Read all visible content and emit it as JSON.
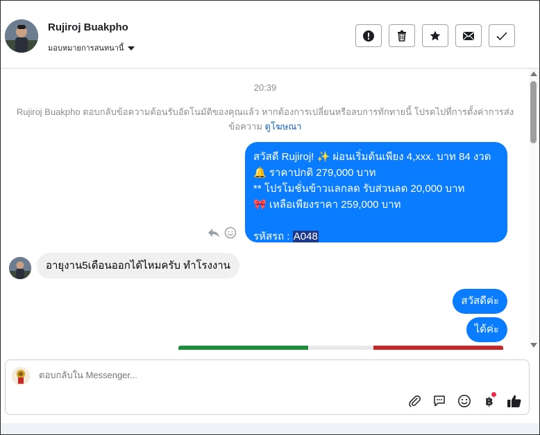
{
  "header": {
    "contact_name": "Rujiroj Buakpho",
    "assign_label": "มอบหมายการสนทนานี้",
    "actions": [
      {
        "name": "important",
        "icon": "exclamation-circle-icon"
      },
      {
        "name": "delete",
        "icon": "trash-icon"
      },
      {
        "name": "star",
        "icon": "star-icon"
      },
      {
        "name": "mark-unread",
        "icon": "envelope-icon"
      },
      {
        "name": "mark-done",
        "icon": "checkmark-icon"
      }
    ]
  },
  "chat": {
    "timestamp": "20:39",
    "notice_text": "Rujiroj Buakpho ตอบกลับข้อความต้อนรับอัตโนมัติของคุณแล้ว หากต้องการเปลี่ยนหรือลบการทักทายนี้ โปรดไปที่การตั้งค่าการส่งข้อความ",
    "notice_link": "ดูโฆษณา",
    "main_message": {
      "line1": "สวัสดี Rujiroj! ✨  ผ่อนเริ่มต้นเพียง 4,xxx. บาท 84 งวด",
      "line2": "🔔 ราคาปกติ 279,000 บาท",
      "line3": "** โปรโมชั่นข้าวแลกลด รับส่วนลด 20,000 บาท",
      "line4": "🎀  เหลือเพียงราคา 259,000 บาท",
      "code_label": " รหัสรถ : ",
      "code_value": "A048"
    },
    "incoming_message": "อายุงาน5เดือนออกได้ไหมครับ ทำโรงงาน",
    "reply_1": "สวัสดีค่ะ",
    "reply_2": "ได้ค่ะ"
  },
  "composer": {
    "placeholder": "ตอบกลับใน Messenger...",
    "tools": [
      "paperclip-icon",
      "speech-bubble-icon",
      "smiley-icon",
      "baht-icon",
      "thumbs-up-icon"
    ],
    "baht_symbol": "฿"
  },
  "colors": {
    "accent_blue": "#0a7cff",
    "link_blue": "#1565c0",
    "muted_text": "#8a8d91",
    "incoming_bg": "#f0f0f0",
    "notification_red": "#f02849"
  }
}
